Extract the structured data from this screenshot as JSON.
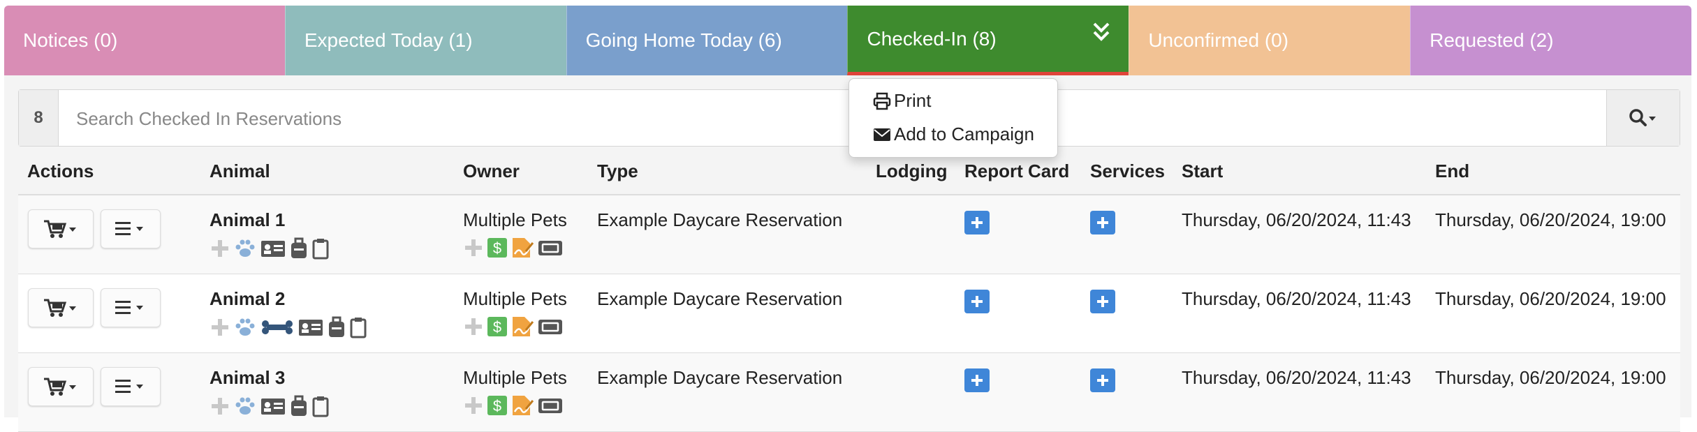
{
  "tabs": [
    {
      "label": "Notices (0)",
      "color": "#d98db5"
    },
    {
      "label": "Expected Today (1)",
      "color": "#8fbcbc"
    },
    {
      "label": "Going Home Today (6)",
      "color": "#7a9fcc"
    },
    {
      "label": "Checked-In (8)",
      "color": "#3e8b2e",
      "active": true
    },
    {
      "label": "Unconfirmed (0)",
      "color": "#f2c294"
    },
    {
      "label": "Requested (2)",
      "color": "#c690d0"
    }
  ],
  "dropdown": {
    "items": [
      {
        "label": "Print",
        "icon": "printer-icon"
      },
      {
        "label": "Add to Campaign",
        "icon": "envelope-icon"
      }
    ]
  },
  "search": {
    "count": "8",
    "placeholder": "Search Checked In Reservations"
  },
  "table": {
    "headers": [
      "Actions",
      "Animal",
      "Owner",
      "Type",
      "Lodging",
      "Report Card",
      "Services",
      "Start",
      "End"
    ],
    "rows": [
      {
        "animal": "Animal 1",
        "owner": "Multiple Pets",
        "type": "Example Daycare Reservation",
        "lodging": "",
        "start": "Thursday, 06/20/2024, 11:43",
        "end": "Thursday, 06/20/2024, 19:00",
        "animal_icons": [
          "plus-icon",
          "paw-icon",
          "id-card-icon",
          "bag-icon",
          "clipboard-icon"
        ]
      },
      {
        "animal": "Animal 2",
        "owner": "Multiple Pets",
        "type": "Example Daycare Reservation",
        "lodging": "",
        "start": "Thursday, 06/20/2024, 11:43",
        "end": "Thursday, 06/20/2024, 19:00",
        "animal_icons": [
          "plus-icon",
          "paw-icon",
          "bone-icon",
          "id-card-icon",
          "bag-icon",
          "clipboard-icon"
        ]
      },
      {
        "animal": "Animal 3",
        "owner": "Multiple Pets",
        "type": "Example Daycare Reservation",
        "lodging": "",
        "start": "Thursday, 06/20/2024, 11:43",
        "end": "Thursday, 06/20/2024, 19:00",
        "animal_icons": [
          "plus-icon",
          "paw-icon",
          "id-card-icon",
          "bag-icon",
          "clipboard-icon"
        ]
      }
    ]
  },
  "colors": {
    "accent_blue": "#3f86d8",
    "money_green": "#5cb85c",
    "sign_orange": "#f0a340",
    "icon_gray": "#555555",
    "icon_light": "#c8c8c8",
    "paw_blue": "#8ab0d8",
    "bone_navy": "#34557a"
  }
}
